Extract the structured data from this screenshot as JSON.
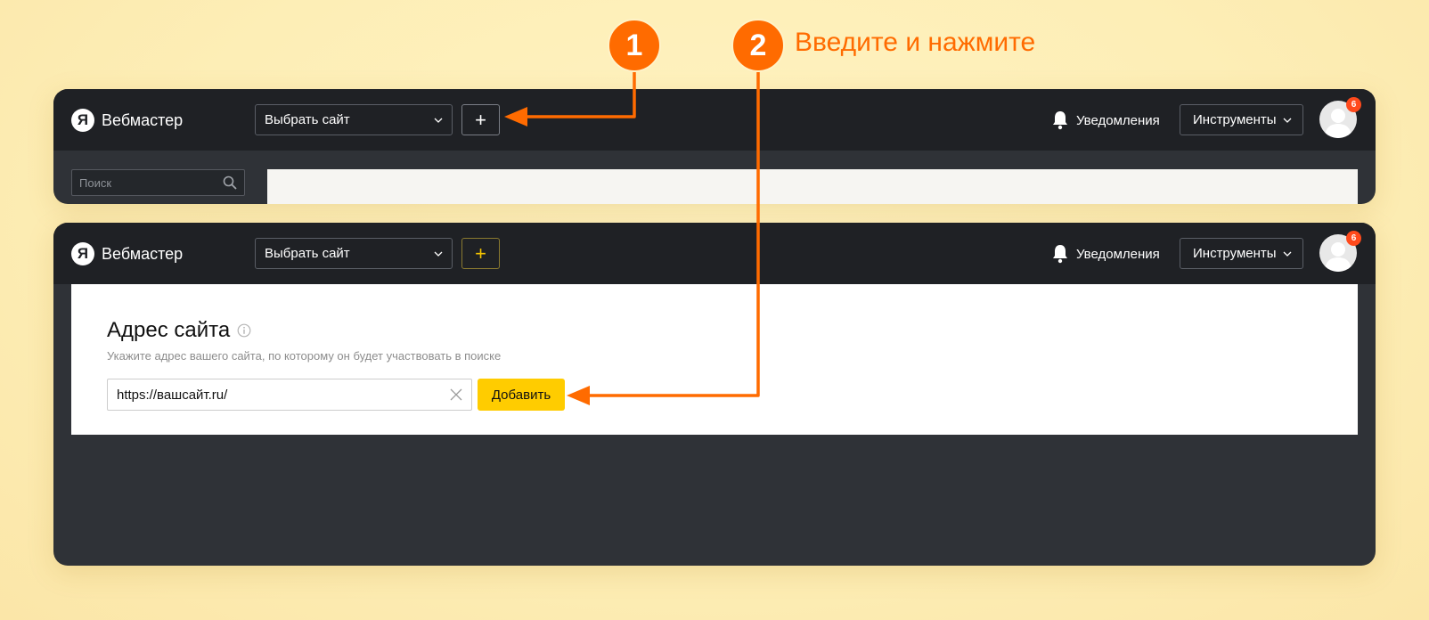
{
  "annotation": {
    "step1_number": "1",
    "step2_number": "2",
    "step2_caption": "Введите и нажмите",
    "accent_color": "#ff6b00"
  },
  "panel1": {
    "logo_letter": "Я",
    "logo_text": "Вебмастер",
    "site_select_label": "Выбрать сайт",
    "add_button_label": "+",
    "notifications_label": "Уведомления",
    "tools_label": "Инструменты",
    "avatar_badge": "6",
    "search_placeholder": "Поиск"
  },
  "panel2": {
    "logo_letter": "Я",
    "logo_text": "Вебмастер",
    "site_select_label": "Выбрать сайт",
    "add_button_label": "+",
    "notifications_label": "Уведомления",
    "tools_label": "Инструменты",
    "avatar_badge": "6",
    "form": {
      "title": "Адрес сайта",
      "hint": "Укажите адрес вашего сайта, по которому он будет участвовать в поиске",
      "url_value": "https://вашсайт.ru/",
      "submit_label": "Добавить"
    }
  },
  "colors": {
    "topbar": "#1f2125",
    "window": "#2f3237",
    "yellow_button": "#ffcc00",
    "badge": "#ff4a1c",
    "background": "#fdeeb6"
  }
}
